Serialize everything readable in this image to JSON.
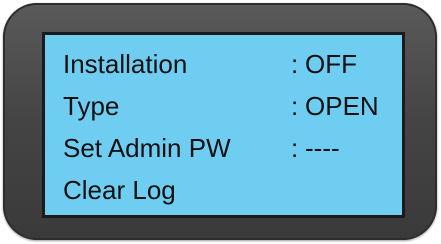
{
  "menu": {
    "items": [
      {
        "label": "Installation",
        "separator": ":",
        "value": "OFF"
      },
      {
        "label": "Type",
        "separator": ":",
        "value": "OPEN"
      },
      {
        "label": "Set Admin PW",
        "separator": ":",
        "value": "----"
      },
      {
        "label": "Clear Log"
      }
    ]
  },
  "colors": {
    "screen_background": "#6fcdf2",
    "frame": "#444444",
    "text": "#111111"
  }
}
